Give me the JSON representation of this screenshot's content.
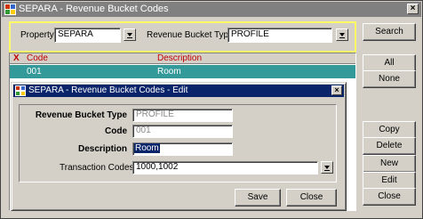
{
  "window": {
    "title": "SEPARA - Revenue Bucket Codes",
    "close": "×"
  },
  "filter": {
    "property_label": "Property",
    "property_value": "SEPARA",
    "bucket_type_label": "Revenue Bucket Type",
    "bucket_type_value": "PROFILE"
  },
  "grid": {
    "headers": {
      "x": "X",
      "code": "Code",
      "description": "Description"
    },
    "rows": [
      {
        "code": "001",
        "description": "Room"
      }
    ]
  },
  "side_buttons": {
    "search": "Search",
    "all": "All",
    "none": "None",
    "copy": "Copy",
    "delete": "Delete",
    "new": "New",
    "edit": "Edit",
    "close": "Close"
  },
  "dialog": {
    "title": "SEPARA - Revenue Bucket Codes - Edit",
    "close": "×",
    "revenue_bucket_type_label": "Revenue Bucket Type",
    "revenue_bucket_type_value": "PROFILE",
    "code_label": "Code",
    "code_value": "001",
    "description_label": "Description",
    "description_value": "Room",
    "transaction_codes_label": "Transaction Codes",
    "transaction_codes_value": "1000,1002",
    "save": "Save",
    "close_button": "Close"
  }
}
